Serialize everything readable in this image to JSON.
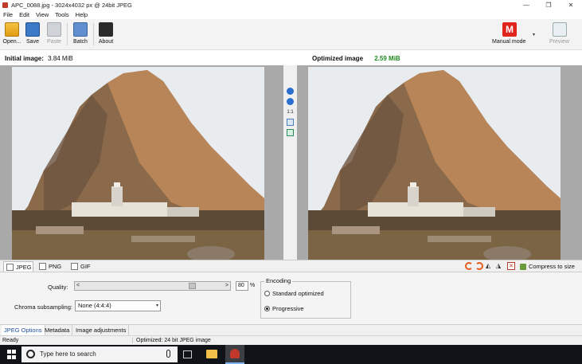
{
  "window": {
    "title": "APC_0088.jpg - 3024x4032 px @ 24bit JPEG",
    "minimize": "—",
    "restore": "❐",
    "close": "✕"
  },
  "menu": [
    "File",
    "Edit",
    "View",
    "Tools",
    "Help"
  ],
  "toolbar": {
    "open": "Open...",
    "save": "Save",
    "paste": "Paste",
    "batch": "Batch",
    "about": "About",
    "mode_icon": "M",
    "mode": "Manual mode",
    "mode_arrow": "▾",
    "preview": "Preview"
  },
  "info": {
    "initial_label": "Initial image:",
    "initial_size": "3.84 MiB",
    "optimized_label": "Optimized image",
    "optimized_size": "2.59 MiB",
    "optimized_color": "#1f8a1f"
  },
  "zoom_tools": {
    "actual": "1:1",
    "icons": [
      "zoom-in-icon",
      "zoom-out-icon",
      "actual-size-icon",
      "fit-window-icon",
      "full-screen-icon"
    ]
  },
  "format_tabs": [
    "JPEG",
    "PNG",
    "GIF"
  ],
  "image_tools": {
    "flip_h": "◭",
    "flip_v": "◮",
    "crop": "✕",
    "compress": "Compress to size"
  },
  "options": {
    "quality_label": "Quality:",
    "slider_left": "<",
    "slider_right": ">",
    "quality_value": "80",
    "quality_percent": 80,
    "quality_unit": "%",
    "chroma_label": "Chroma subsampling:",
    "chroma_value": "None (4:4:4)",
    "chroma_arrow": "▾",
    "encoding_title": "Encoding",
    "encoding_standard": "Standard optimized",
    "encoding_progressive": "Progressive",
    "encoding_selected": "Progressive"
  },
  "option_tabs": [
    "JPEG Options",
    "Metadata",
    "Image adjustments"
  ],
  "status": {
    "left": "Ready",
    "right": "Optimized: 24 bit JPEG image"
  },
  "taskbar": {
    "search_placeholder": "Type here to search"
  }
}
